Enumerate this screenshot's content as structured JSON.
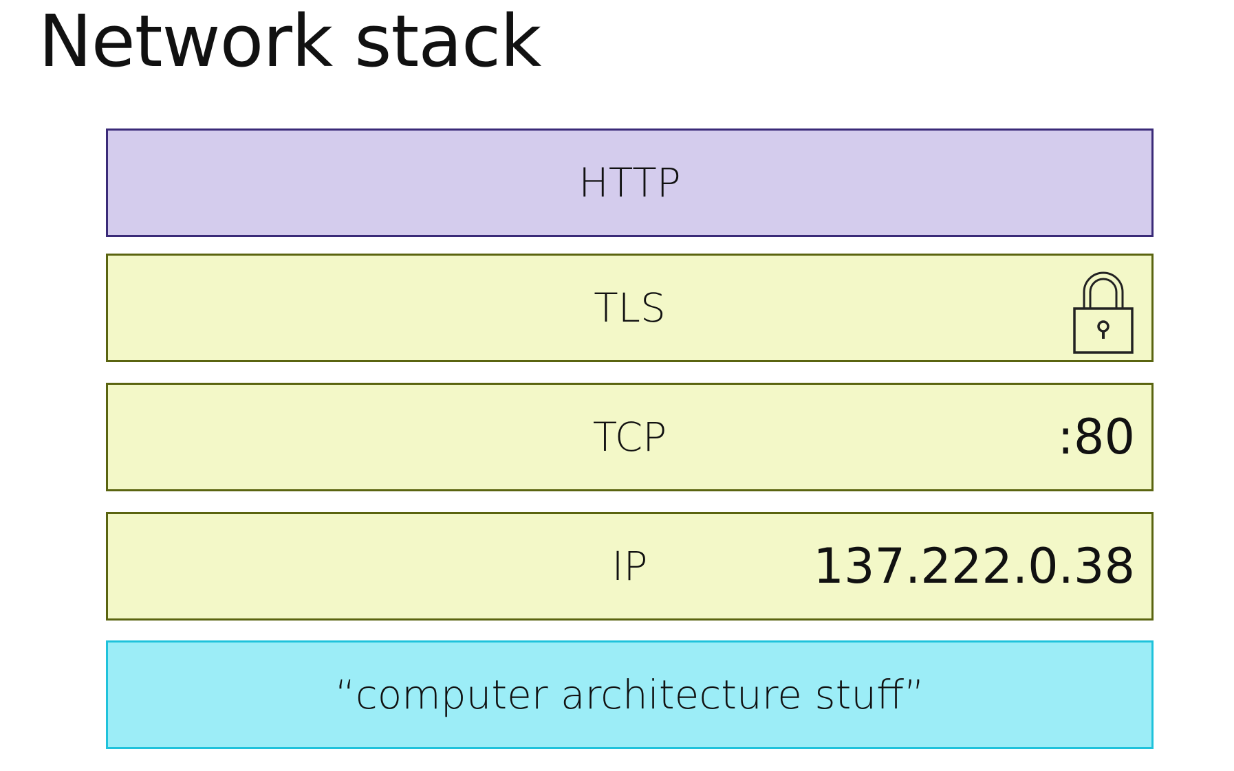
{
  "title": "Network stack",
  "layers": [
    {
      "label": "HTTP",
      "fill": "#d4cced",
      "border": "#3a2a78"
    },
    {
      "label": "TLS",
      "fill": "#f3f8c8",
      "border": "#5a6410",
      "icon": "lock-icon"
    },
    {
      "label": "TCP",
      "fill": "#f3f8c8",
      "border": "#5a6410",
      "value": ":80"
    },
    {
      "label": "IP",
      "fill": "#f3f8c8",
      "border": "#5a6410",
      "value": "137.222.0.38"
    },
    {
      "label": "“computer architecture stuff”",
      "fill": "#9cedf7",
      "border": "#1fc2db"
    }
  ]
}
